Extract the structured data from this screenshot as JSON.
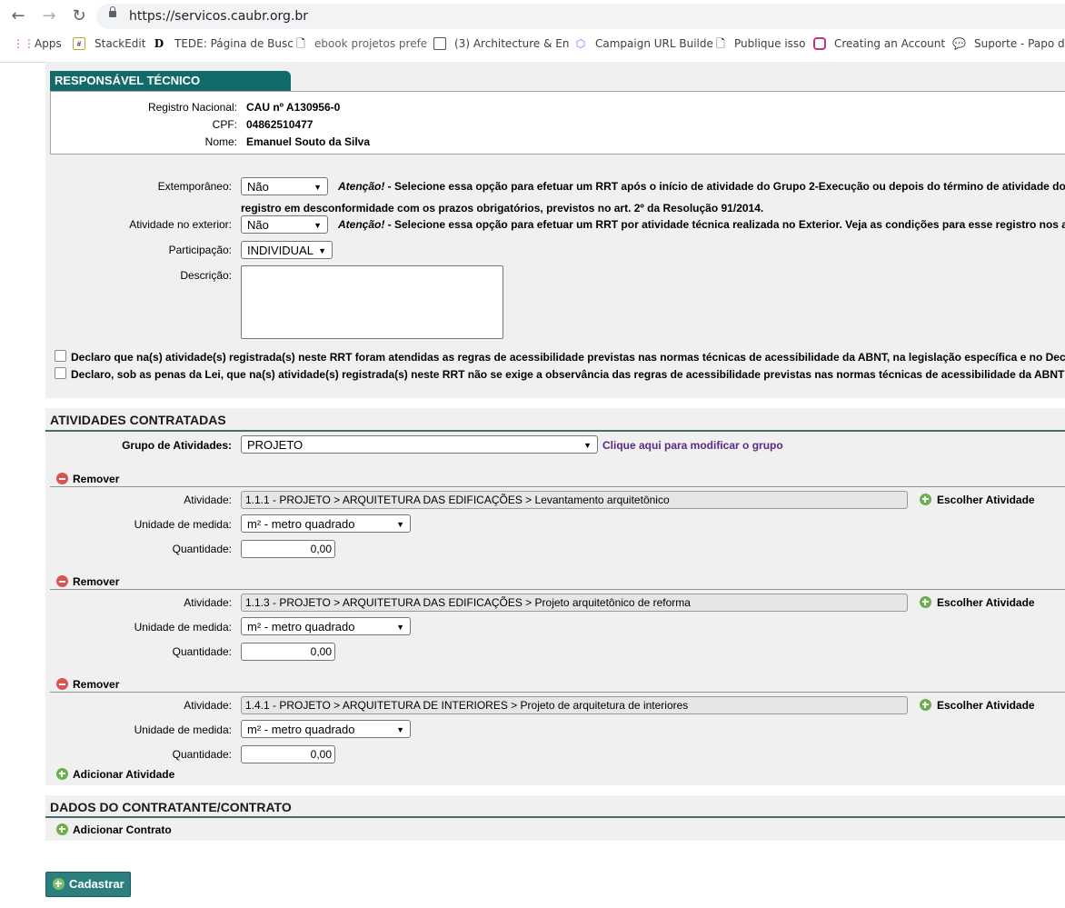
{
  "browser": {
    "url": "https://servicos.caubr.org.br",
    "bookmarks": [
      "Apps",
      "StackEdit",
      "TEDE: Página de Busc",
      "ebook projetos prefe",
      "(3) Architecture & En",
      "Campaign URL Builde",
      "Publique isso",
      "Creating an Account",
      "Suporte - Papo de"
    ]
  },
  "responsavel": {
    "tab_title": "RESPONSÁVEL TÉCNICO",
    "registro_label": "Registro Nacional:",
    "registro_value": "CAU nº A130956-0",
    "cpf_label": "CPF:",
    "cpf_value": "04862510477",
    "nome_label": "Nome:",
    "nome_value": "Emanuel Souto da Silva"
  },
  "form": {
    "extemporaneo_label": "Extemporâneo:",
    "extemporaneo_value": "Não",
    "extemporaneo_note_em": "Atenção!",
    "extemporaneo_note": " - Selecione essa opção para efetuar um RRT após o início de atividade do Grupo 2-Execução ou depois do término de atividade do",
    "extemporaneo_note2": "registro em desconformidade com os prazos obrigatórios, previstos no art. 2º da Resolução 91/2014.",
    "exterior_label": "Atividade no exterior:",
    "exterior_value": "Não",
    "exterior_note_em": "Atenção!",
    "exterior_note": " - Selecione essa opção para efetuar um RRT por atividade técnica realizada no Exterior. Veja as condições para esse registro nos ar",
    "participacao_label": "Participação:",
    "participacao_value": "INDIVIDUAL",
    "descricao_label": "Descrição:",
    "declaro1": "Declaro que na(s) atividade(s) registrada(s) neste RRT foram atendidas as regras de acessibilidade previstas nas normas técnicas de acessibilidade da ABNT, na legislação específica e no Dec",
    "declaro2": "Declaro, sob as penas da Lei, que na(s) atividade(s) registrada(s) neste RRT não se exige a observância das regras de acessibilidade previstas nas normas técnicas de acessibilidade da ABNT"
  },
  "atividades": {
    "title": "ATIVIDADES CONTRATADAS",
    "grupo_label": "Grupo de Atividades:",
    "grupo_value": "PROJETO",
    "grupo_link": "Clique aqui para modificar o grupo",
    "remover_label": "Remover",
    "atividade_label": "Atividade:",
    "unidade_label": "Unidade de medida:",
    "quantidade_label": "Quantidade:",
    "escolher_label": "Escolher Atividade",
    "adicionar_label": "Adicionar Atividade",
    "items": [
      {
        "atividade": "1.1.1 - PROJETO > ARQUITETURA DAS EDIFICAÇÕES > Levantamento arquitetônico",
        "unidade": "m² - metro quadrado",
        "quantidade": "0,00"
      },
      {
        "atividade": "1.1.3 - PROJETO > ARQUITETURA DAS EDIFICAÇÕES >  Projeto arquitetônico de reforma",
        "unidade": "m² - metro quadrado",
        "quantidade": "0,00"
      },
      {
        "atividade": "1.4.1  - PROJETO > ARQUITETURA DE INTERIORES > Projeto de arquitetura de interiores",
        "unidade": "m² - metro quadrado",
        "quantidade": "0,00"
      }
    ]
  },
  "contratante": {
    "title": "DADOS DO CONTRATANTE/CONTRATO",
    "adicionar_label": "Adicionar Contrato"
  },
  "submit": {
    "label": "Cadastrar"
  }
}
